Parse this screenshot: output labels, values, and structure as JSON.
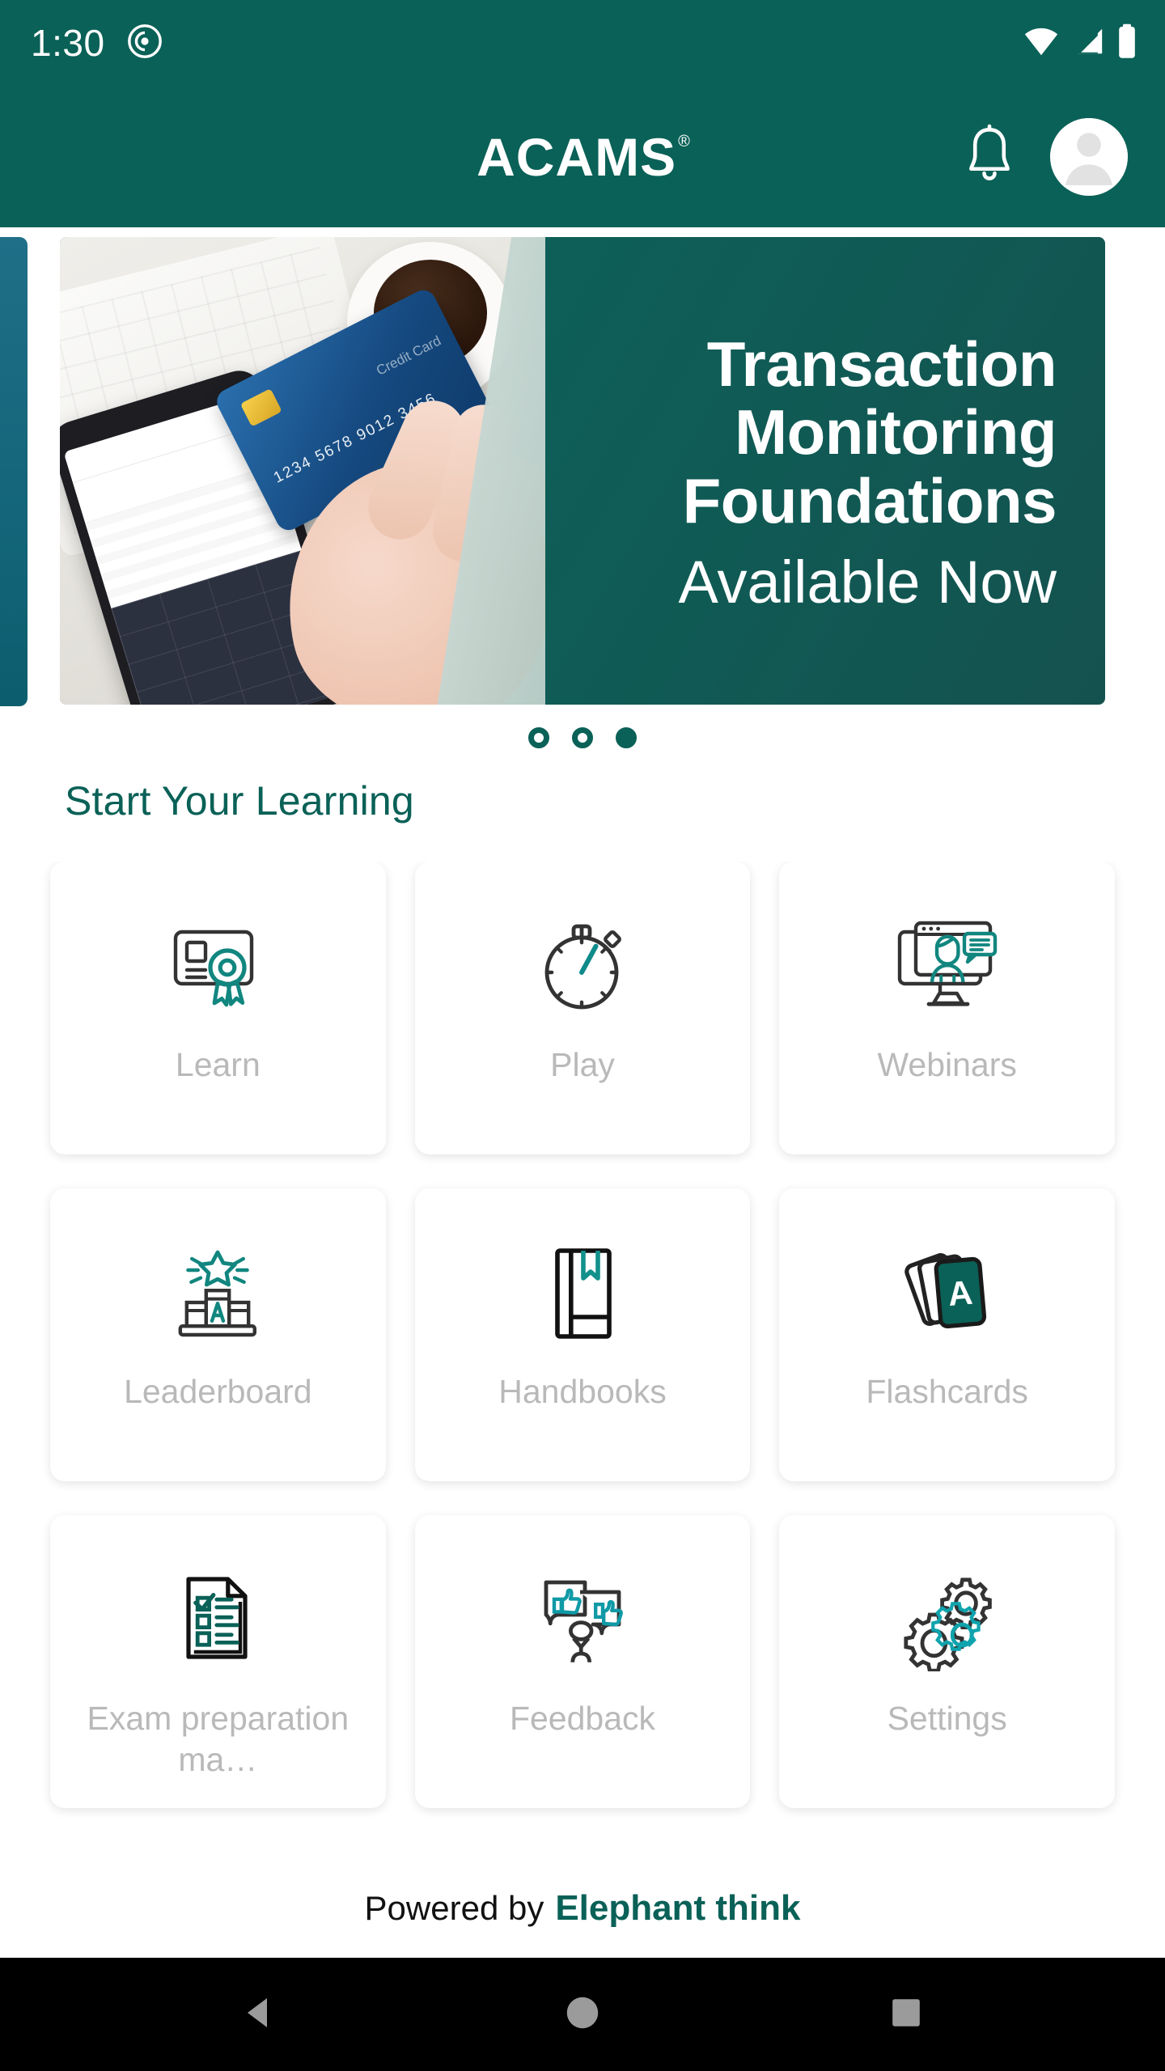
{
  "status_bar": {
    "time": "1:30",
    "icons": [
      "screen-record-icon",
      "wifi-icon",
      "cellular-signal-icon",
      "battery-icon"
    ]
  },
  "app_bar": {
    "brand": "ACAMS",
    "registered_mark": "®",
    "notification_icon": "bell-icon",
    "avatar_icon": "user-avatar-icon"
  },
  "carousel": {
    "slides": [
      {
        "title": "Transaction Monitoring Foundations",
        "subtitle": "Available Now",
        "photo_alt": "hand-holding-credit-card-near-phone"
      }
    ],
    "dots": [
      {
        "active": false
      },
      {
        "active": false
      },
      {
        "active": true
      }
    ]
  },
  "learning": {
    "section_title": "Start Your Learning",
    "tiles": [
      {
        "label": "Learn",
        "icon": "certificate-award-icon"
      },
      {
        "label": "Play",
        "icon": "stopwatch-icon"
      },
      {
        "label": "Webinars",
        "icon": "monitor-presenter-icon"
      },
      {
        "label": "Leaderboard",
        "icon": "podium-star-icon"
      },
      {
        "label": "Handbooks",
        "icon": "book-bookmark-icon"
      },
      {
        "label": "Flashcards",
        "icon": "flashcards-stack-icon"
      },
      {
        "label": "Exam preparation ma…",
        "icon": "checklist-document-icon"
      },
      {
        "label": "Feedback",
        "icon": "thumbs-feedback-icon"
      },
      {
        "label": "Settings",
        "icon": "gears-icon"
      }
    ]
  },
  "footer": {
    "prefix": "Powered by",
    "brand": "Elephant think"
  },
  "nav_bar": {
    "back": "back-triangle-icon",
    "home": "home-circle-icon",
    "recents": "recents-square-icon"
  },
  "colors": {
    "brand_teal": "#0a6157",
    "accent_teal": "#108a8a",
    "tile_label_gray": "#b9b9b9",
    "page_bg": "#ffffff",
    "nav_bg": "#000000"
  }
}
